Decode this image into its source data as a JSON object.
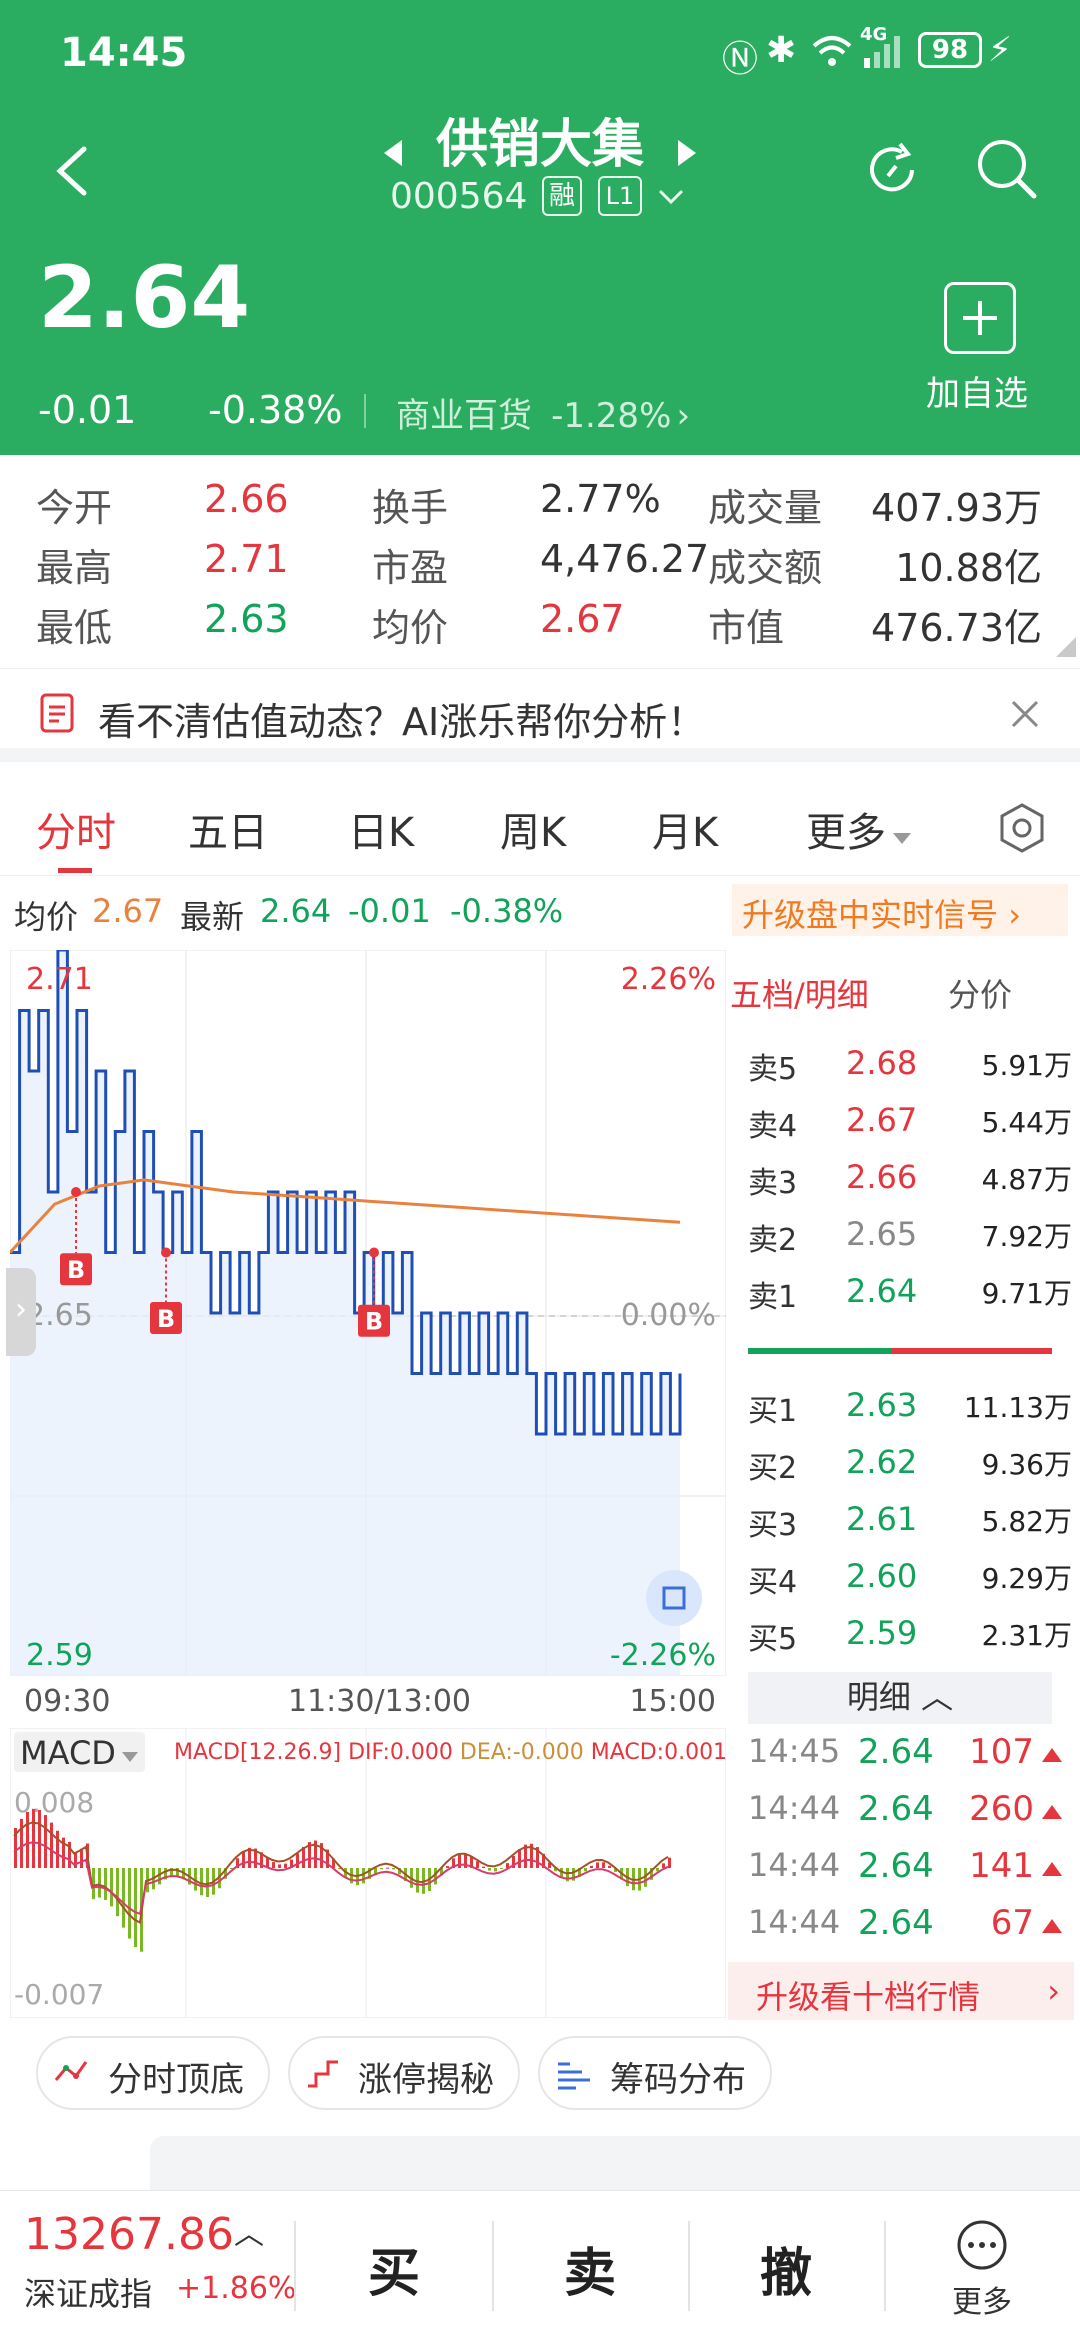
{
  "status_bar": {
    "time": "14:45",
    "battery": "98",
    "network": "4G"
  },
  "header": {
    "title": "供销大集",
    "code": "000564",
    "badge_margin": "融",
    "badge_level": "L1",
    "price": "2.64",
    "change": "-0.01",
    "change_pct": "-0.38%",
    "sector": "商业百货",
    "sector_change": "-1.28%",
    "add_watch": "加自选"
  },
  "stats": {
    "open_label": "今开",
    "open": "2.66",
    "high_label": "最高",
    "high": "2.71",
    "low_label": "最低",
    "low": "2.63",
    "turnover_label": "换手",
    "turnover": "2.77%",
    "pe_label": "市盈",
    "pe": "4,476.27",
    "avg_label": "均价",
    "avg": "2.67",
    "volume_label": "成交量",
    "volume": "407.93万",
    "amount_label": "成交额",
    "amount": "10.88亿",
    "mcap_label": "市值",
    "mcap": "476.73亿"
  },
  "ai_banner": {
    "text": "看不清估值动态？AI涨乐帮你分析！"
  },
  "tabs": [
    {
      "label": "分时"
    },
    {
      "label": "五日"
    },
    {
      "label": "日K"
    },
    {
      "label": "周K"
    },
    {
      "label": "月K"
    },
    {
      "label": "更多"
    }
  ],
  "price_bar": {
    "avg_label": "均价",
    "avg": "2.67",
    "latest_label": "最新",
    "latest": "2.64",
    "chg": "-0.01",
    "chg_pct": "-0.38%",
    "upgrade": "升级盘中实时信号"
  },
  "chart": {
    "y_top": "2.71",
    "y_mid": "2.65",
    "y_bot": "2.59",
    "pct_top": "2.26%",
    "pct_mid": "0.00%",
    "pct_bot": "-2.26%",
    "x_start": "09:30",
    "x_mid": "11:30/13:00",
    "x_end": "15:00",
    "buy_marker": "B"
  },
  "chart_data": {
    "type": "line",
    "xlabel": "",
    "ylabel": "",
    "ylim": [
      2.59,
      2.71
    ],
    "series": [
      {
        "values": [
          2.66,
          2.7,
          2.69,
          2.7,
          2.67,
          2.71,
          2.68,
          2.7,
          2.67,
          2.69,
          2.66,
          2.68,
          2.69,
          2.66,
          2.68,
          2.67,
          2.66,
          2.67,
          2.66,
          2.68,
          2.66,
          2.65,
          2.66,
          2.65,
          2.66,
          2.65,
          2.66,
          2.67,
          2.66,
          2.67,
          2.66,
          2.67,
          2.66,
          2.67,
          2.66,
          2.67,
          2.65,
          2.66,
          2.65,
          2.66,
          2.65,
          2.66,
          2.64,
          2.65,
          2.64,
          2.65,
          2.64,
          2.65,
          2.64,
          2.65,
          2.64,
          2.65,
          2.64,
          2.65,
          2.64,
          2.63,
          2.64,
          2.63,
          2.64,
          2.63,
          2.64,
          2.63,
          2.64,
          2.63,
          2.64,
          2.63,
          2.64,
          2.63,
          2.64,
          2.63,
          2.64
        ]
      },
      {
        "values": [
          2.66,
          2.668,
          2.671,
          2.672,
          2.671,
          2.67,
          2.6695,
          2.669,
          2.6685,
          2.668,
          2.6675,
          2.667,
          2.6665,
          2.666,
          2.6655,
          2.665
        ]
      }
    ]
  },
  "order_book": {
    "header_left": "五档/明细",
    "header_right": "分价",
    "sells": [
      {
        "label": "卖5",
        "price": "2.68",
        "vol": "5.91万"
      },
      {
        "label": "卖4",
        "price": "2.67",
        "vol": "5.44万"
      },
      {
        "label": "卖3",
        "price": "2.66",
        "vol": "4.87万"
      },
      {
        "label": "卖2",
        "price": "2.65",
        "vol": "7.92万"
      },
      {
        "label": "卖1",
        "price": "2.64",
        "vol": "9.71万"
      }
    ],
    "buys": [
      {
        "label": "买1",
        "price": "2.63",
        "vol": "11.13万"
      },
      {
        "label": "买2",
        "price": "2.62",
        "vol": "9.36万"
      },
      {
        "label": "买3",
        "price": "2.61",
        "vol": "5.82万"
      },
      {
        "label": "买4",
        "price": "2.60",
        "vol": "9.29万"
      },
      {
        "label": "买5",
        "price": "2.59",
        "vol": "2.31万"
      }
    ],
    "detail_label": "明细",
    "details": [
      {
        "time": "14:45",
        "price": "2.64",
        "vol": "107"
      },
      {
        "time": "14:44",
        "price": "2.64",
        "vol": "260"
      },
      {
        "time": "14:44",
        "price": "2.64",
        "vol": "141"
      },
      {
        "time": "14:44",
        "price": "2.64",
        "vol": "67"
      }
    ],
    "upgrade": "升级看十档行情"
  },
  "macd": {
    "label": "MACD",
    "params": "MACD[12.26.9]",
    "dif": "DIF:0.000",
    "dea": "DEA:-0.000",
    "macd": "MACD:0.001",
    "y_top": "0.008",
    "y_bot": "-0.007"
  },
  "tools": [
    {
      "label": "分时顶底"
    },
    {
      "label": "涨停揭秘"
    },
    {
      "label": "筹码分布"
    }
  ],
  "bottom": {
    "index_value": "13267.86",
    "index_name": "深证成指",
    "index_change": "+1.86%",
    "buy": "买",
    "sell": "卖",
    "cancel": "撤",
    "more": "更多"
  },
  "colors": {
    "brand": "#2bad61",
    "up": "#e5353d",
    "down": "#12a35a",
    "avg_line": "#e8823e",
    "price_line": "#1f4fb5"
  }
}
